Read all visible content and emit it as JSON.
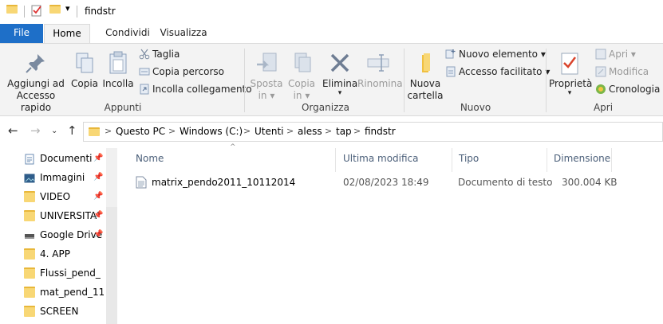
{
  "window": {
    "title": "findstr",
    "quick_access_dropdown": "▾"
  },
  "ribbon_tabs": [
    "File",
    "Home",
    "Condividi",
    "Visualizza"
  ],
  "ribbon": {
    "appunti": {
      "label": "Appunti",
      "pin_label": "Aggiungi ad Accesso rapido",
      "copy_label": "Copia",
      "paste_label": "Incolla",
      "cut_label": "Taglia",
      "copy_path_label": "Copia percorso",
      "paste_shortcut_label": "Incolla collegamento"
    },
    "organizza": {
      "label": "Organizza",
      "move_label": "Sposta in",
      "copyto_label": "Copia in",
      "delete_label": "Elimina",
      "rename_label": "Rinomina"
    },
    "nuovo": {
      "label": "Nuovo",
      "new_folder_label": "Nuova cartella",
      "new_item_label": "Nuovo elemento",
      "easy_access_label": "Accesso facilitato"
    },
    "apri": {
      "label": "Apri",
      "properties_label": "Proprietà",
      "open_label": "Apri",
      "edit_label": "Modifica",
      "history_label": "Cronologia"
    }
  },
  "address": {
    "crumbs": [
      "Questo PC",
      "Windows (C:)",
      "Utenti",
      "aless",
      "tap",
      "findstr"
    ]
  },
  "sidebar": {
    "items": [
      {
        "label": "Documenti",
        "icon": "document-icon",
        "pinned": true
      },
      {
        "label": "Immagini",
        "icon": "image-icon",
        "pinned": true
      },
      {
        "label": "VIDEO",
        "icon": "folder-icon",
        "pinned": true
      },
      {
        "label": "UNIVERSITA'",
        "icon": "folder-icon",
        "pinned": true
      },
      {
        "label": "Google Drive",
        "icon": "drive-icon",
        "pinned": true
      },
      {
        "label": "4. APP",
        "icon": "folder-icon",
        "pinned": false
      },
      {
        "label": "Flussi_pend_",
        "icon": "folder-icon",
        "pinned": false
      },
      {
        "label": "mat_pend_11",
        "icon": "folder-icon",
        "pinned": false
      },
      {
        "label": "SCREEN",
        "icon": "folder-icon",
        "pinned": false
      }
    ]
  },
  "file_list": {
    "columns": [
      "Nome",
      "Ultima modifica",
      "Tipo",
      "Dimensione"
    ],
    "rows": [
      {
        "name": "matrix_pendo2011_10112014",
        "modified": "02/08/2023 18:49",
        "type": "Documento di testo",
        "size": "300.004 KB"
      }
    ]
  },
  "colors": {
    "file_tab": "#1e6fc8",
    "ribbon_bg": "#f3f3f3",
    "folder_yellow": "#f8d775",
    "header_text": "#4c607a",
    "delete_red": "#c42b1c"
  }
}
